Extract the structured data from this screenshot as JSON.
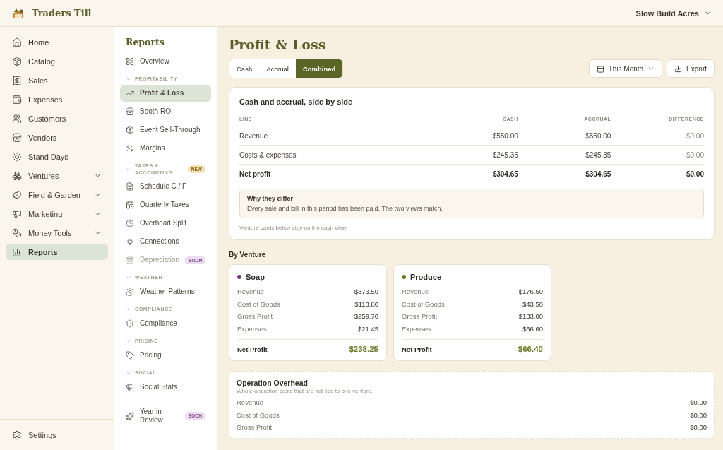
{
  "brand": {
    "name": "Traders Till"
  },
  "account": {
    "label": "Slow Build Acres"
  },
  "nav": {
    "items": [
      {
        "label": "Home",
        "selected": false,
        "expandable": false
      },
      {
        "label": "Catalog",
        "selected": false,
        "expandable": false
      },
      {
        "label": "Sales",
        "selected": false,
        "expandable": false
      },
      {
        "label": "Expenses",
        "selected": false,
        "expandable": false
      },
      {
        "label": "Customers",
        "selected": false,
        "expandable": false
      },
      {
        "label": "Vendors",
        "selected": false,
        "expandable": false
      },
      {
        "label": "Stand Days",
        "selected": false,
        "expandable": false
      },
      {
        "label": "Ventures",
        "selected": false,
        "expandable": true
      },
      {
        "label": "Field & Garden",
        "selected": false,
        "expandable": true
      },
      {
        "label": "Marketing",
        "selected": false,
        "expandable": true
      },
      {
        "label": "Money Tools",
        "selected": false,
        "expandable": true
      },
      {
        "label": "Reports",
        "selected": true,
        "expandable": false
      }
    ],
    "footer": {
      "label": "Settings"
    }
  },
  "subnav": {
    "title": "Reports",
    "entries": [
      {
        "kind": "item",
        "label": "Overview",
        "selected": false,
        "disabled": false
      },
      {
        "kind": "section",
        "label": "PROFITABILITY",
        "expanded": true
      },
      {
        "kind": "item",
        "label": "Profit & Loss",
        "selected": true,
        "disabled": false
      },
      {
        "kind": "item",
        "label": "Booth ROI",
        "selected": false,
        "disabled": false
      },
      {
        "kind": "item",
        "label": "Event Sell-Through",
        "selected": false,
        "disabled": false
      },
      {
        "kind": "item",
        "label": "Margins",
        "selected": false,
        "disabled": false
      },
      {
        "kind": "section",
        "label": "TAXES & ACCOUNTING",
        "expanded": true,
        "badge": "NEW"
      },
      {
        "kind": "item",
        "label": "Schedule C / F",
        "selected": false,
        "disabled": false
      },
      {
        "kind": "item",
        "label": "Quarterly Taxes",
        "selected": false,
        "disabled": false
      },
      {
        "kind": "item",
        "label": "Overhead Split",
        "selected": false,
        "disabled": false
      },
      {
        "kind": "item",
        "label": "Connections",
        "selected": false,
        "disabled": false
      },
      {
        "kind": "item",
        "label": "Depreciation",
        "selected": false,
        "disabled": true,
        "badge": "SOON"
      },
      {
        "kind": "section",
        "label": "WEATHER",
        "expanded": true
      },
      {
        "kind": "item",
        "label": "Weather Patterns",
        "selected": false,
        "disabled": false
      },
      {
        "kind": "section",
        "label": "COMPLIANCE",
        "expanded": true
      },
      {
        "kind": "item",
        "label": "Compliance",
        "selected": false,
        "disabled": false
      },
      {
        "kind": "section",
        "label": "PRICING",
        "expanded": true
      },
      {
        "kind": "item",
        "label": "Pricing",
        "selected": false,
        "disabled": false
      },
      {
        "kind": "section",
        "label": "SOCIAL",
        "expanded": true
      },
      {
        "kind": "item",
        "label": "Social Stats",
        "selected": false,
        "disabled": false
      },
      {
        "kind": "divider"
      },
      {
        "kind": "item",
        "label": "Year in Review",
        "selected": false,
        "disabled": false,
        "badge": "SOON"
      }
    ]
  },
  "page": {
    "title": "Profit & Loss",
    "view_tabs": [
      {
        "label": "Cash",
        "selected": false
      },
      {
        "label": "Accrual",
        "selected": false
      },
      {
        "label": "Combined",
        "selected": true
      }
    ],
    "period": {
      "label": "This Month"
    },
    "export": {
      "label": "Export"
    }
  },
  "comparison": {
    "title": "Cash and accrual, side by side",
    "columns": [
      "LINE",
      "CASH",
      "ACCRUAL",
      "DIFFERENCE"
    ],
    "rows": [
      {
        "cells": [
          "Revenue",
          "$550.00",
          "$550.00",
          "$0.00"
        ],
        "total": false
      },
      {
        "cells": [
          "Costs & expenses",
          "$245.35",
          "$245.35",
          "$0.00"
        ],
        "total": false
      },
      {
        "cells": [
          "Net profit",
          "$304.65",
          "$304.65",
          "$0.00"
        ],
        "total": true
      }
    ],
    "note": {
      "title": "Why they differ",
      "text": "Every sale and bill in this period has been paid. The two views match."
    },
    "footnote": "Venture cards below stay on the cash view."
  },
  "by_venture": {
    "heading": "By Venture",
    "ventures": [
      {
        "name": "Soap",
        "color": "#6e3a7c",
        "lines": [
          {
            "label": "Revenue",
            "value": "$373.50"
          },
          {
            "label": "Cost of Goods",
            "value": "$113.80"
          },
          {
            "label": "Gross Profit",
            "value": "$259.70"
          },
          {
            "label": "Expenses",
            "value": "$21.45"
          }
        ],
        "net": {
          "label": "Net Profit",
          "value": "$238.25"
        }
      },
      {
        "name": "Produce",
        "color": "#6b7d2a",
        "lines": [
          {
            "label": "Revenue",
            "value": "$176.50"
          },
          {
            "label": "Cost of Goods",
            "value": "$43.50"
          },
          {
            "label": "Gross Profit",
            "value": "$133.00"
          },
          {
            "label": "Expenses",
            "value": "$66.60"
          }
        ],
        "net": {
          "label": "Net Profit",
          "value": "$66.40"
        }
      }
    ]
  },
  "overhead": {
    "title": "Operation Overhead",
    "subtitle": "Whole-operation costs that are not tied to one venture.",
    "lines": [
      {
        "label": "Revenue",
        "value": "$0.00"
      },
      {
        "label": "Cost of Goods",
        "value": "$0.00"
      },
      {
        "label": "Gross Profit",
        "value": "$0.00"
      }
    ]
  }
}
